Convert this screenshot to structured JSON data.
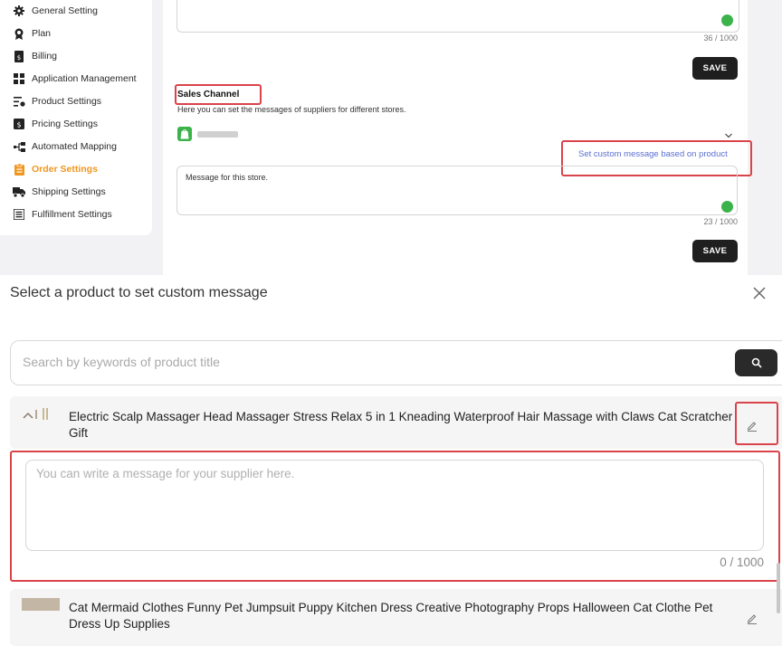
{
  "sidebar": {
    "items": [
      {
        "label": "General Setting",
        "icon": "gear-icon"
      },
      {
        "label": "Plan",
        "icon": "award-icon"
      },
      {
        "label": "Billing",
        "icon": "invoice-icon"
      },
      {
        "label": "Application Management",
        "icon": "grid-icon"
      },
      {
        "label": "Product Settings",
        "icon": "product-settings-icon"
      },
      {
        "label": "Pricing Settings",
        "icon": "dollar-icon"
      },
      {
        "label": "Automated Mapping",
        "icon": "mapping-icon"
      },
      {
        "label": "Order Settings",
        "icon": "clipboard-icon",
        "active": true
      },
      {
        "label": "Shipping Settings",
        "icon": "truck-icon"
      },
      {
        "label": "Fulfillment Settings",
        "icon": "list-icon"
      }
    ],
    "active_color": "#f0961e"
  },
  "main": {
    "top_counter": "36 / 1000",
    "save_label": "SAVE",
    "sales_channel": {
      "title": "Sales Channel",
      "description": "Here you can set the messages of suppliers for different stores.",
      "custom_link": "Set custom message based on product",
      "store_message": "Message for this store.",
      "counter": "23 / 1000",
      "save_label": "SAVE"
    }
  },
  "modal": {
    "title": "Select a product to set custom message",
    "search_placeholder": "Search by keywords of product title",
    "products": [
      {
        "title": "Electric Scalp Massager Head Massager Stress Relax 5 in 1 Kneading Waterproof Hair Massage with Claws Cat Scratcher Gift",
        "message_placeholder": "You can write a message for your supplier here.",
        "message_value": "",
        "counter": "0 / 1000"
      },
      {
        "title": "Cat Mermaid Clothes Funny Pet Jumpsuit Puppy Kitchen Dress Creative Photography Props Halloween Cat Clothe Pet Dress Up Supplies"
      }
    ]
  },
  "colors": {
    "highlight_border": "#d9434a",
    "link": "#5b6fd1",
    "save_button": "#1f1f1f",
    "shopify_green": "#3cb24a"
  }
}
